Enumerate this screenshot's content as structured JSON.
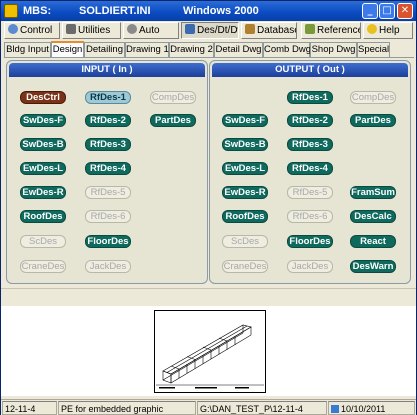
{
  "titlebar": {
    "part1": "MBS:",
    "part2": "SOLDIERT.INI",
    "part3": "Windows 2000"
  },
  "toolbar": [
    {
      "label": "Control",
      "icon": "magnifier-icon"
    },
    {
      "label": "Utilities",
      "icon": "wrench-icon"
    },
    {
      "label": "Auto",
      "icon": "gear-icon"
    },
    {
      "label": "Des/Dt/Dwg",
      "icon": "drawing-icon"
    },
    {
      "label": "Database",
      "icon": "database-icon"
    },
    {
      "label": "Reference",
      "icon": "book-icon"
    },
    {
      "label": "Help",
      "icon": "help-icon"
    }
  ],
  "tabs": [
    "Bldg Input",
    "Design",
    "Detailing",
    "Drawing 1",
    "Drawing 2",
    "Detail Dwg",
    "Comb Dwg",
    "Shop Dwg",
    "Special"
  ],
  "active_tab": "Design",
  "input_panel": {
    "title": "INPUT ( In )",
    "buttons": [
      "DesCtrl",
      "RfDes-1",
      "CompDes",
      "SwDes-F",
      "RfDes-2",
      "PartDes",
      "SwDes-B",
      "RfDes-3",
      "EwDes-L",
      "RfDes-4",
      "EwDes-R",
      "RfDes-5",
      "RoofDes",
      "RfDes-6",
      "ScDes",
      "FloorDes",
      "CraneDes",
      "JackDes"
    ]
  },
  "output_panel": {
    "title": "OUTPUT ( Out )",
    "buttons": [
      "RfDes-1",
      "CompDes",
      "SwDes-F",
      "RfDes-2",
      "PartDes",
      "SwDes-B",
      "RfDes-3",
      "EwDes-L",
      "RfDes-4",
      "EwDes-R",
      "RfDes-5",
      "FramSum",
      "RoofDes",
      "RfDes-6",
      "DesCalc",
      "ScDes",
      "FloorDes",
      "React",
      "CraneDes",
      "JackDes",
      "DesWarn"
    ]
  },
  "status": {
    "left": "12-11-4",
    "message": "PE for embedded graphic",
    "path": "G:\\DAN_TEST_P\\12-11-4",
    "date": "10/10/2011"
  },
  "colors": {
    "titlebar": "#0a4ac0",
    "button_on": "#0f6a5e",
    "button_selected": "#9ec9d6",
    "button_desctrl": "#7a3218",
    "panel_header": "#1c3f9a",
    "active_tab_accent": "#e68b2c"
  }
}
